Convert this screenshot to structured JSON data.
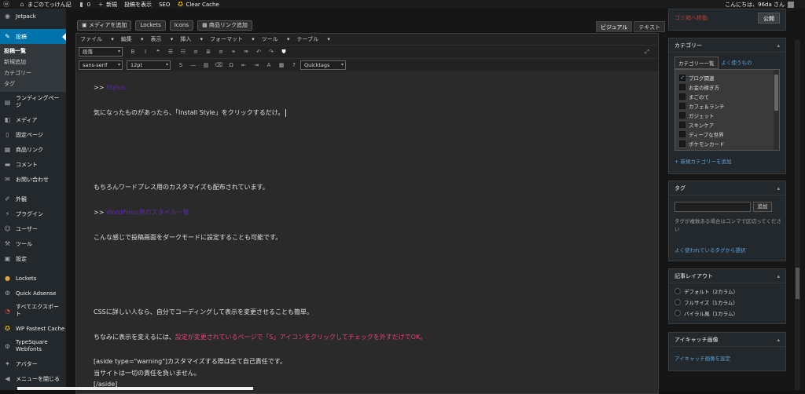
{
  "adminbar": {
    "jetpack_icon": "wp-logo-icon",
    "site_name": "まごのてっけん記",
    "comments": "0",
    "new": "新規",
    "view_post": "投稿を表示",
    "seo": "SEO",
    "clear_cache": "Clear Cache",
    "greeting": "こんにちは、96da さん"
  },
  "sidebar": {
    "jetpack": "Jetpack",
    "posts": "投稿",
    "sub": [
      "投稿一覧",
      "新規追加",
      "カテゴリー",
      "タグ"
    ],
    "items": [
      "ランディングページ",
      "メディア",
      "固定ページ",
      "商品リンク",
      "コメント",
      "お問い合わせ",
      "外観",
      "プラグイン",
      "ユーザー",
      "ツール",
      "設定",
      "Lockets",
      "Quick Adsense",
      "すべてエクスポート",
      "WP Fastest Cache",
      "TypeSquare Webfonts",
      "アバター",
      "メニューを閉じる"
    ]
  },
  "toolbar": {
    "add_media": "メディアを追加",
    "lockets": "Lockets",
    "icons": "Icons",
    "product_link": "商品リンク追加",
    "visual": "ビジュアル",
    "text": "テキスト"
  },
  "menus": [
    "ファイル",
    "編集",
    "表示",
    "挿入",
    "フォーマット",
    "ツール",
    "テーブル"
  ],
  "format": {
    "paragraph": "段落",
    "font": "sans-serif",
    "size": "12pt",
    "quicktags": "Quicktags"
  },
  "body": {
    "l1_prefix": ">> ",
    "l1_link": "Stylus",
    "l2": "気になったものがあったら、「Install Style」をクリックするだけ。",
    "l3": "もちろんワードプレス用のカスタマイズも配布されています。",
    "l4_prefix": ">> ",
    "l4_link": "WordPress用のスタイル一覧",
    "l5": "こんな感じで投稿画面をダークモードに設定することも可能です。",
    "l6": "CSSに詳しい人なら、自分でコーディングして表示を変更させることも簡単。",
    "l7_a": "ちなみに表示を変えるには、",
    "l7_b": "設定が変更されているページで「S」アイコンをクリックしてチェックを外すだけでOK。",
    "l8": "[aside type=\"warning\"]カスタマイズする際は全て自己責任です。",
    "l9": "当サイトは一切の責任を負いません。",
    "l10": "[/aside]"
  },
  "publish": {
    "trash": "ゴミ箱へ移動",
    "button": "公開"
  },
  "category": {
    "title": "カテゴリー",
    "tab_all": "カテゴリー一覧",
    "tab_used": "よく使うもの",
    "items": [
      "ブログ関連",
      "お金の稼ぎ方",
      "まごのて",
      "カフェ＆ランチ",
      "ガジェット",
      "スキンケア",
      "ディープな世界",
      "ポケモンカード"
    ],
    "add": "+ 新規カテゴリーを追加"
  },
  "tags": {
    "title": "タグ",
    "add": "追加",
    "note": "タグが複数ある場合はコンマで区切ってください",
    "choose": "よく使われているタグから選択"
  },
  "layout": {
    "title": "記事レイアウト",
    "options": [
      "デフォルト（2カラム）",
      "フルサイズ（1カラム）",
      "バイラル風（1カラム）"
    ]
  },
  "thumb": {
    "title": "アイキャッチ画像",
    "set": "アイキャッチ画像を設定"
  }
}
